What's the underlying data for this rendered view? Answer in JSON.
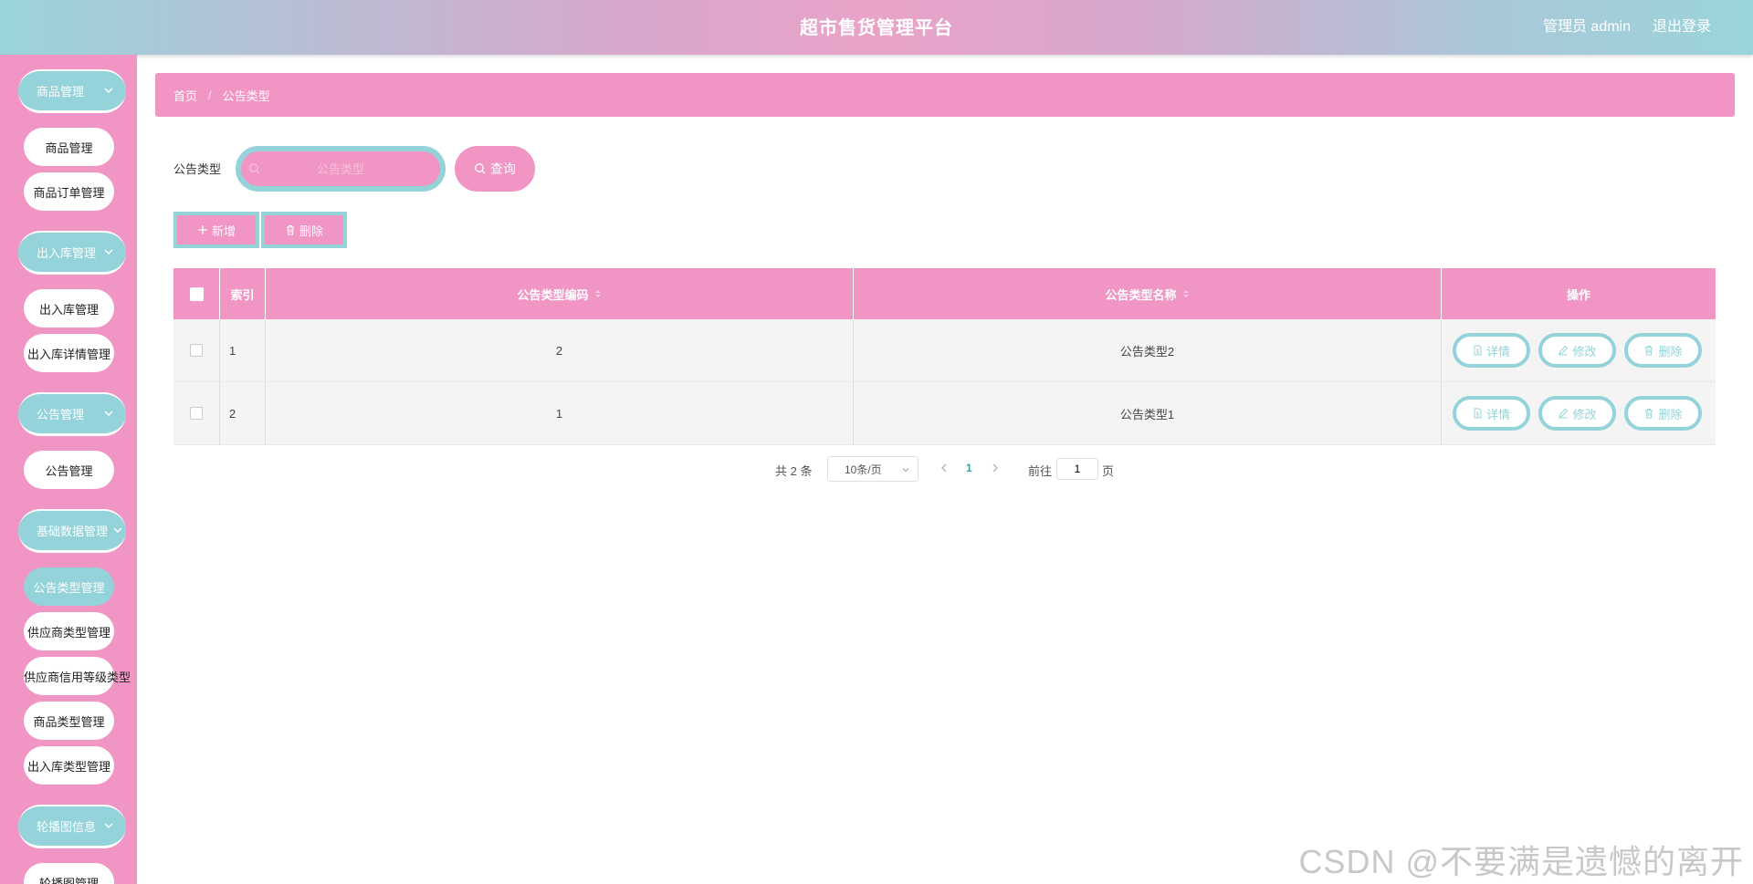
{
  "header": {
    "title": "超市售货管理平台",
    "user": "管理员 admin",
    "logout": "退出登录"
  },
  "sidebar": {
    "groups": [
      {
        "label": "商品管理",
        "items": [
          "商品管理",
          "商品订单管理"
        ]
      },
      {
        "label": "出入库管理",
        "items": [
          "出入库管理",
          "出入库详情管理"
        ]
      },
      {
        "label": "公告管理",
        "items": [
          "公告管理"
        ]
      },
      {
        "label": "基础数据管理",
        "items": [
          "公告类型管理",
          "供应商类型管理",
          "供应商信用等级类型",
          "商品类型管理",
          "出入库类型管理"
        ]
      },
      {
        "label": "轮播图信息",
        "items": [
          "轮播图管理"
        ]
      }
    ],
    "active_item": "公告类型管理"
  },
  "breadcrumb": {
    "home": "首页",
    "sep": "/",
    "current": "公告类型"
  },
  "search": {
    "label": "公告类型",
    "placeholder": "公告类型",
    "query_button": "查询"
  },
  "actions": {
    "add": "新增",
    "delete": "删除"
  },
  "table": {
    "columns": [
      "索引",
      "公告类型编码",
      "公告类型名称",
      "操作"
    ],
    "rows": [
      {
        "index": "1",
        "code": "2",
        "name": "公告类型2"
      },
      {
        "index": "2",
        "code": "1",
        "name": "公告类型1"
      }
    ],
    "row_actions": {
      "detail": "详情",
      "edit": "修改",
      "delete": "删除"
    }
  },
  "pagination": {
    "total": "共 2 条",
    "page_size": "10条/页",
    "current_page": "1",
    "goto_label": "前往",
    "goto_value": "1",
    "goto_suffix": "页"
  },
  "watermark": "CSDN @不要满是遗憾的离开",
  "colors": {
    "pink": "#f095c4",
    "teal": "#93d3d9",
    "accent": "#2aa6ad"
  }
}
